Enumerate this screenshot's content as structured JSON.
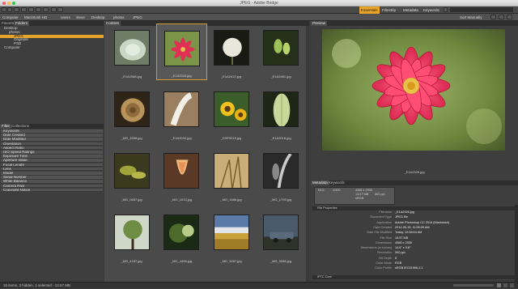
{
  "window": {
    "title": "JPEG - Adobe Bridge"
  },
  "toolbar": {
    "workspaces": [
      "Essentials",
      "Filmstrip",
      "Metadata",
      "Keywords"
    ],
    "sort_label": "Sort Manually",
    "search_placeholder": ""
  },
  "path": [
    "Computer",
    "Macintosh HD",
    "Users",
    "steve",
    "Desktop",
    "photos",
    "JPEG"
  ],
  "left": {
    "tabs": [
      "Favorites",
      "Folders"
    ],
    "tree": [
      "Desktop",
      "photos",
      "JPEG",
      "Originals",
      "PSD",
      "Computer"
    ],
    "filter_tabs": [
      "Filter",
      "Collections"
    ],
    "filters": [
      "Keywords",
      "Date Created",
      "Date Modified",
      "Orientation",
      "Aspect Ratio",
      "ISO Speed Ratings",
      "Exposure Time",
      "Aperture Value",
      "Focal Length",
      "Lens",
      "Model",
      "Serial Number",
      "White Balance",
      "Camera Raw",
      "Copyright Notice"
    ]
  },
  "content": {
    "tab": "Content",
    "items": [
      {
        "name": "_E1A2068.jpg",
        "art": "succulent",
        "selected": false
      },
      {
        "name": "_E1A2326.jpg",
        "art": "dahlia",
        "selected": true
      },
      {
        "name": "_E1A2410.jpg",
        "art": "dandelion",
        "selected": false
      },
      {
        "name": "_E1A2481.jpg",
        "art": "buds",
        "selected": false
      },
      {
        "name": "_MG_1558.jpg",
        "art": "rose",
        "selected": false
      },
      {
        "name": "_E1A2032.jpg",
        "art": "feather",
        "selected": false
      },
      {
        "name": "_DSF0019.jpg",
        "art": "sunflower",
        "selected": false
      },
      {
        "name": "_E1A2016.jpg",
        "art": "leaf",
        "selected": false
      },
      {
        "name": "_MG_0657.jpg",
        "art": "fern",
        "selected": false
      },
      {
        "name": "_MG_1612.jpg",
        "art": "tulip",
        "selected": false
      },
      {
        "name": "_MG_1666.jpg",
        "art": "grass",
        "selected": false
      },
      {
        "name": "_MG_1709.jpg",
        "art": "bw",
        "selected": false
      },
      {
        "name": "_MG_4187.jpg",
        "art": "tree",
        "selected": false
      },
      {
        "name": "_MG_4496.jpg",
        "art": "moss",
        "selected": false
      },
      {
        "name": "_MG_9067.jpg",
        "art": "field",
        "selected": false
      },
      {
        "name": "_MG_9086.jpg",
        "art": "car",
        "selected": false
      }
    ]
  },
  "preview": {
    "tab": "Preview",
    "caption": "_E1A2326.jpg"
  },
  "metadata": {
    "tabs": [
      "Metadata",
      "Keywords"
    ],
    "summary": [
      {
        "label": "f/4.0",
        "value": "1/400"
      },
      {
        "label": "",
        "value": "4368 x 2935"
      },
      {
        "label": "",
        "value": "13.57 MB"
      },
      {
        "label": "",
        "value": "300 ppi"
      },
      {
        "label": "",
        "value": "sRGB"
      }
    ],
    "section": "File Properties",
    "rows": [
      {
        "k": "Filename",
        "v": "_E1A2326.jpg"
      },
      {
        "k": "Document Type",
        "v": "JPEG file"
      },
      {
        "k": "Application",
        "v": "Adobe Photoshop CC 2014 (Macintosh)"
      },
      {
        "k": "Date Created",
        "v": "2014-05-19, 11:55:09 AM"
      },
      {
        "k": "Date File Modified",
        "v": "Today, 12:08:04 AM"
      },
      {
        "k": "File Size",
        "v": "13.57 MB"
      },
      {
        "k": "Dimensions",
        "v": "4368 x 2935"
      },
      {
        "k": "Dimensions (in inches)",
        "v": "14.6\" x 9.8\""
      },
      {
        "k": "Resolution",
        "v": "300 ppi"
      },
      {
        "k": "Bit Depth",
        "v": "8"
      },
      {
        "k": "Color Mode",
        "v": "RGB"
      },
      {
        "k": "Color Profile",
        "v": "sRGB IEC61966-2.1"
      }
    ],
    "section2": "IPTC Core"
  },
  "status": {
    "text": "18 items, 3 hidden, 1 selected - 13.57 MB"
  },
  "colors": {
    "accent": "#e3a52c",
    "bg": "#3c3c3c"
  }
}
